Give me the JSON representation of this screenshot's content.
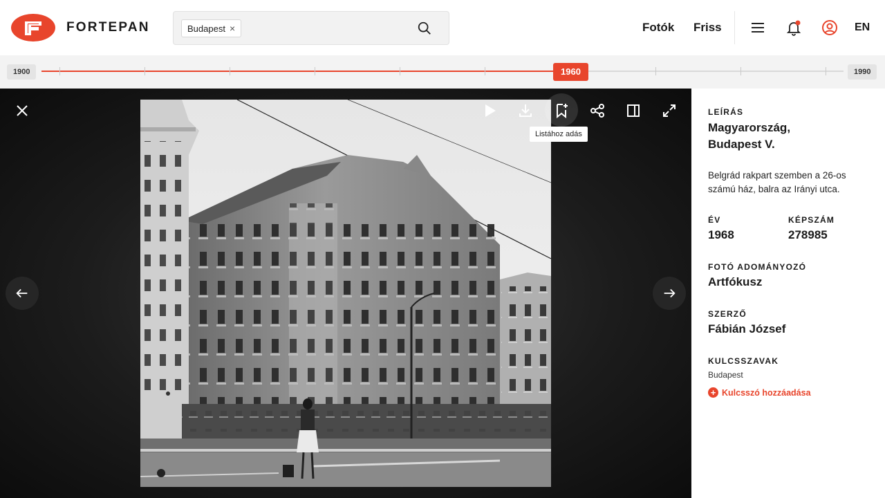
{
  "brand": {
    "name": "FORTEPAN",
    "accent": "#e8452c",
    "logo_letter": "F"
  },
  "search": {
    "chip_label": "Budapest",
    "chip_remove": "×",
    "icon": "search-icon"
  },
  "nav": {
    "photos": "Fotók",
    "fresh": "Friss",
    "lang": "EN",
    "icons": [
      "menu-icon",
      "bell-icon",
      "user-icon"
    ]
  },
  "timeline": {
    "start": "1900",
    "end": "1990",
    "current": "1960",
    "position_fraction": 0.667
  },
  "viewer": {
    "tooltip": "Listához adás",
    "toolbar_icons": [
      "play-icon",
      "download-icon",
      "bookmark-add-icon",
      "share-icon",
      "sidebar-toggle-icon",
      "fullscreen-icon"
    ],
    "close_icon": "close-icon",
    "prev_icon": "arrow-left-icon",
    "next_icon": "arrow-right-icon"
  },
  "details": {
    "desc_label": "LEÍRÁS",
    "title_line1": "Magyarország,",
    "title_line2": "Budapest V.",
    "description": "Belgrád rakpart szemben a 26-os számú ház, balra az Irányi utca.",
    "year_label": "ÉV",
    "year": "1968",
    "id_label": "KÉPSZÁM",
    "id": "278985",
    "donor_label": "FOTÓ ADOMÁNYOZÓ",
    "donor": "Artfókusz",
    "author_label": "SZERZŐ",
    "author": "Fábián József",
    "keywords_label": "KULCSSZAVAK",
    "keyword": "Budapest",
    "add_keyword": "Kulcsszó hozzáadása"
  }
}
